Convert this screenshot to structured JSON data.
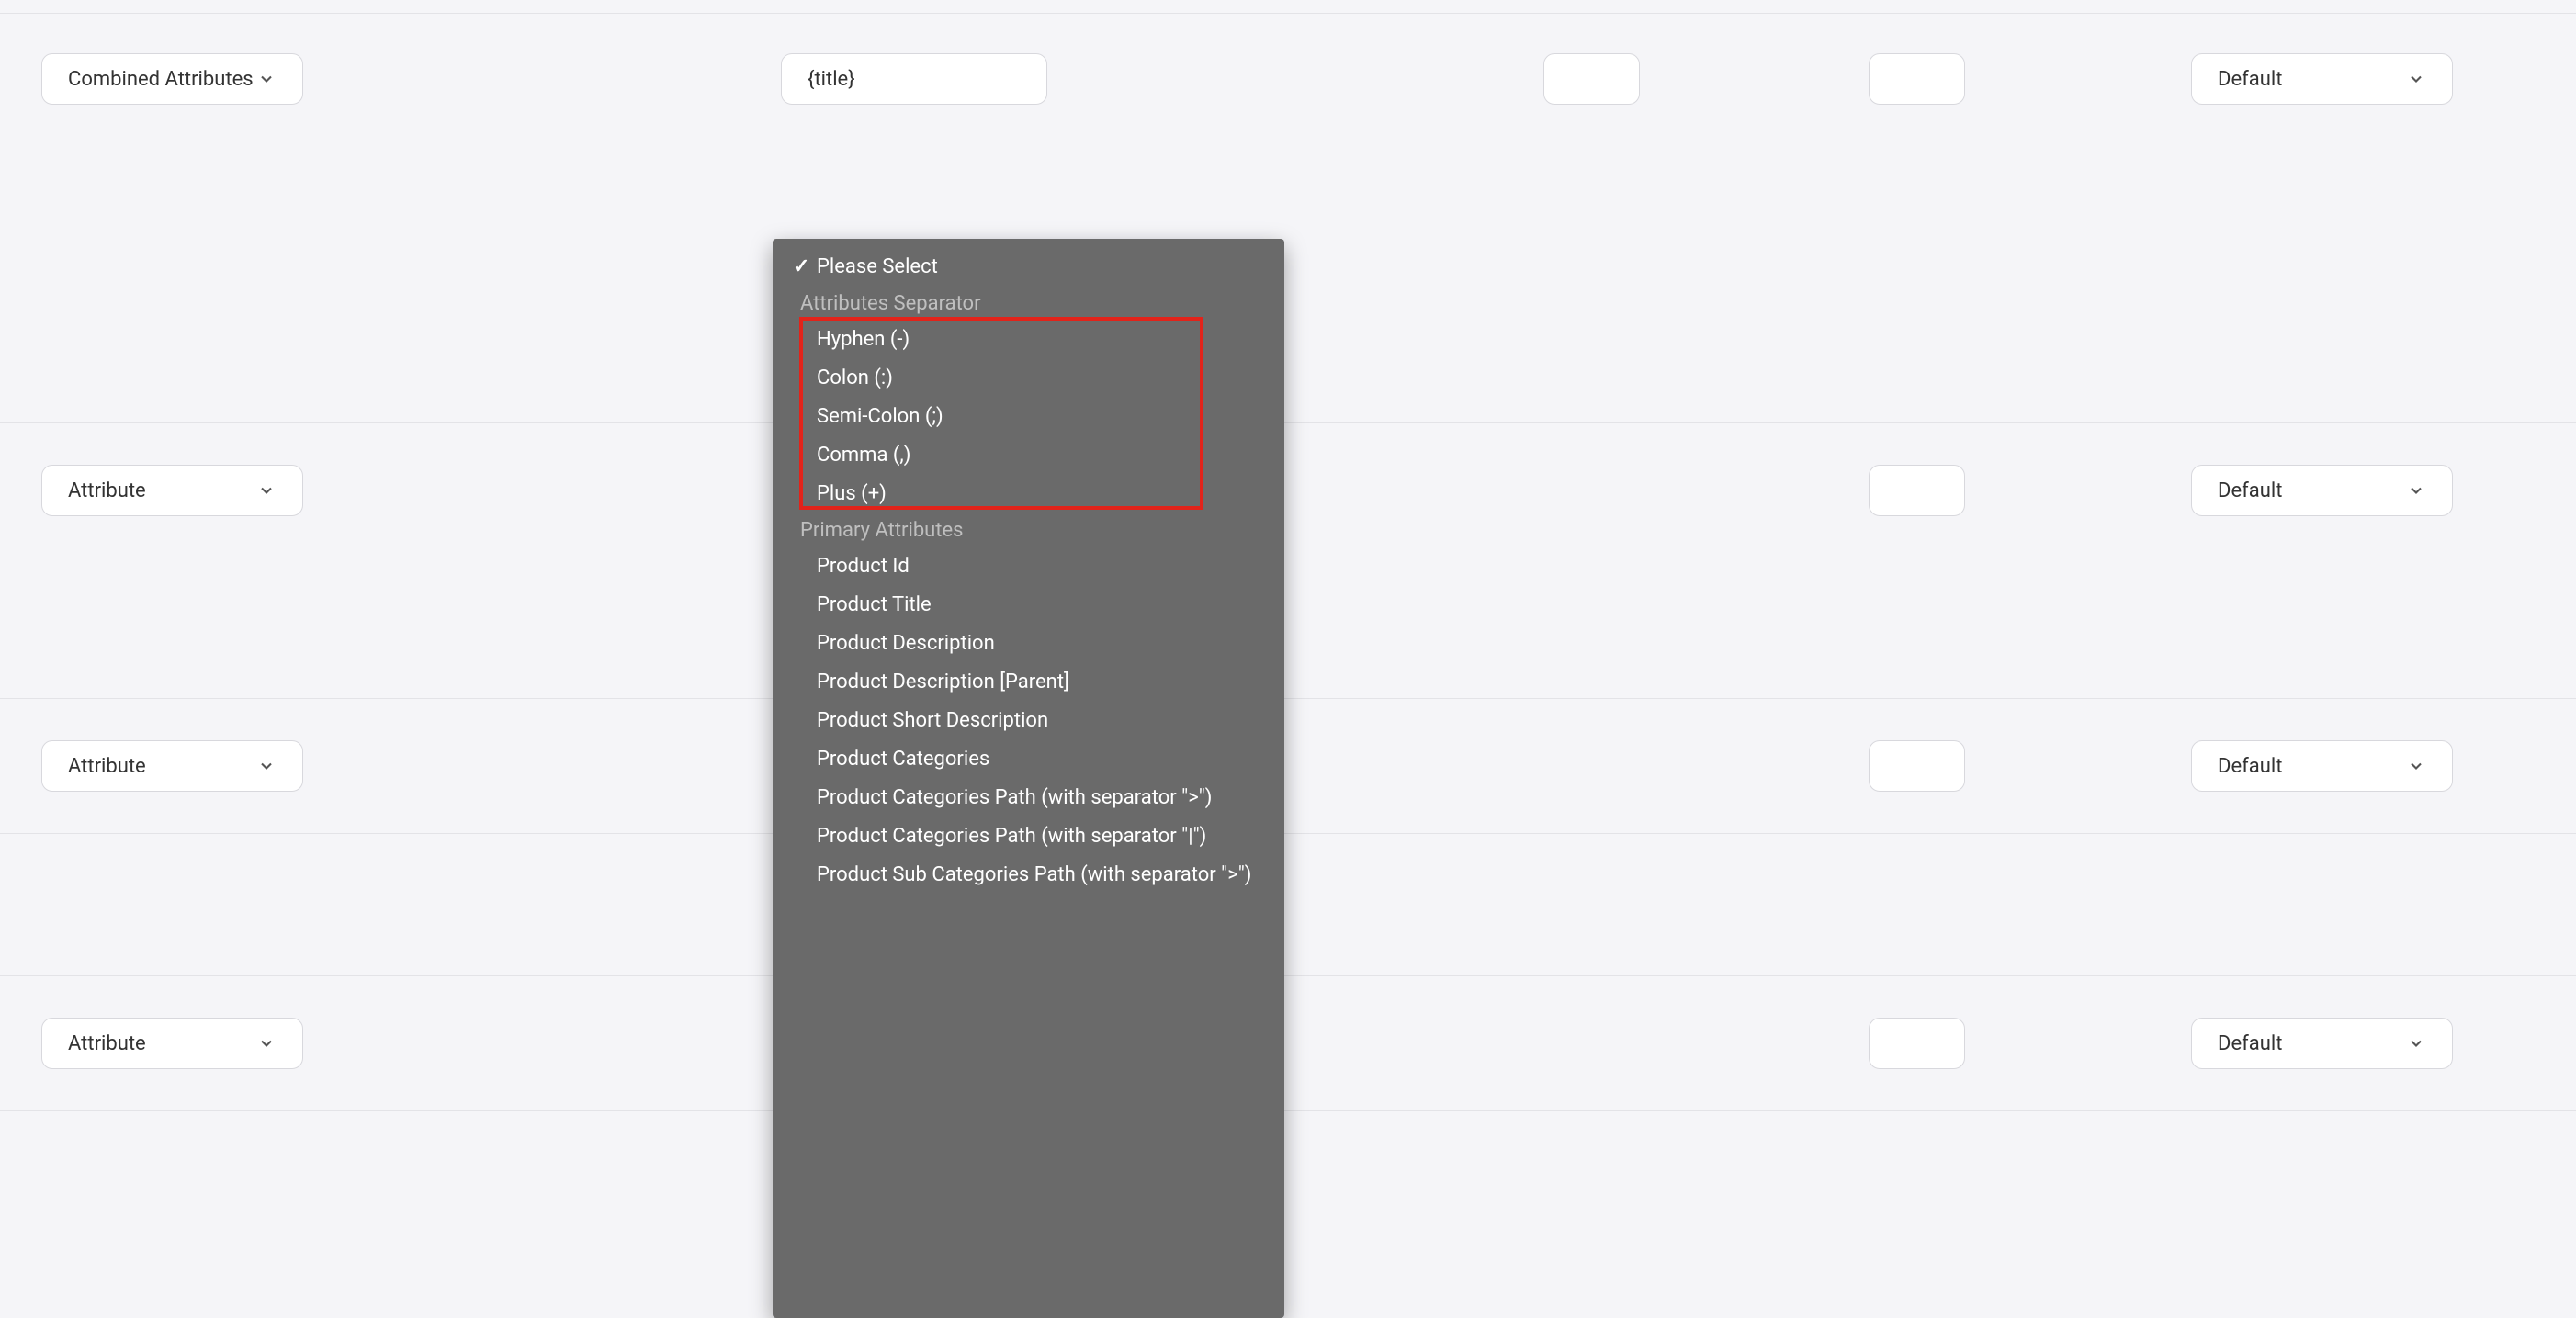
{
  "rows": [
    {
      "attr": "Combined Attributes",
      "value": "{title}",
      "s1": "",
      "s2": "",
      "output": "Default"
    },
    {
      "attr": "Attribute",
      "value": "",
      "s1": "",
      "s2": "",
      "output": "Default"
    },
    {
      "attr": "Attribute",
      "value": "",
      "s1": "",
      "s2": "",
      "output": "Default"
    },
    {
      "attr": "Attribute",
      "value": "",
      "s1": "",
      "s2": "",
      "output": "Default"
    }
  ],
  "dropdown": {
    "selected": "Please Select",
    "groups": [
      {
        "label": "Attributes Separator",
        "items": [
          "Hyphen (-)",
          "Colon (:)",
          "Semi-Colon (;)",
          "Comma (,)",
          "Plus (+)"
        ]
      },
      {
        "label": "Primary Attributes",
        "items": [
          "Product Id",
          "Product Title",
          "Product Description",
          "Product Description [Parent]",
          "Product Short Description",
          "Product Categories",
          "Product Categories Path (with separator \">\")",
          "Product Categories Path (with separator \"|\")",
          "Product Sub Categories Path (with separator \">\")"
        ]
      }
    ]
  }
}
